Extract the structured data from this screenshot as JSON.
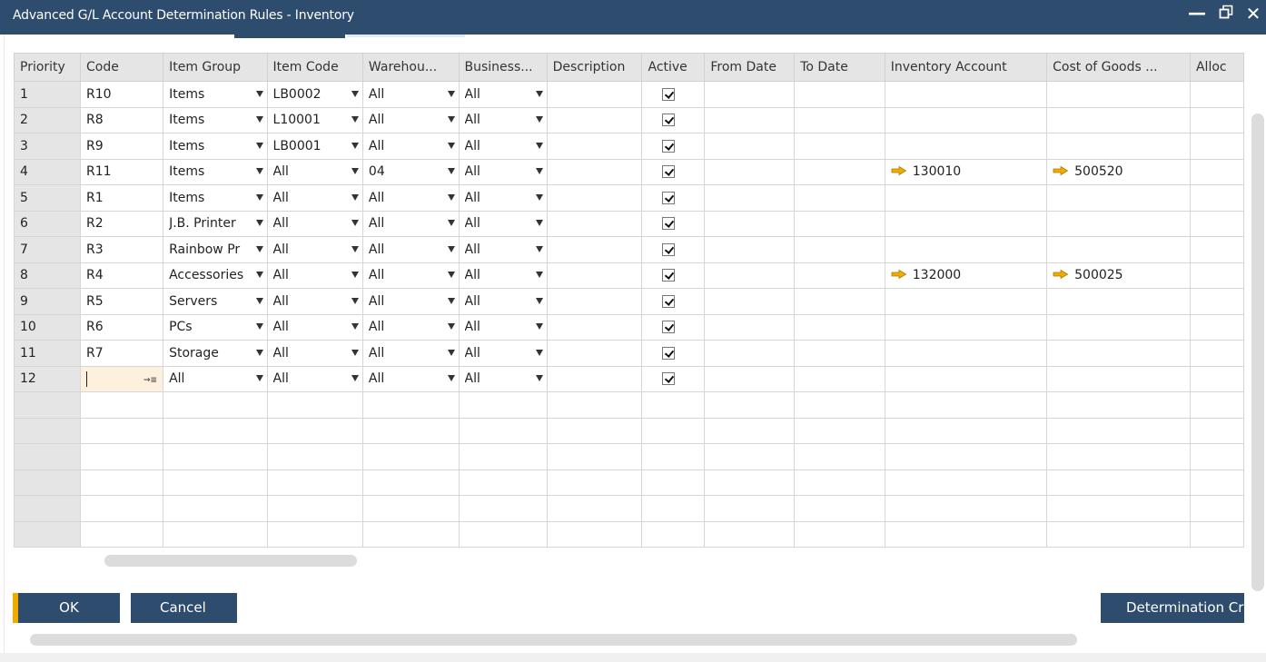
{
  "window": {
    "title": "Advanced G/L Account Determination Rules - Inventory",
    "controls": {
      "minimize": "_",
      "close": "✕"
    }
  },
  "grid": {
    "columns": [
      "Priority",
      "Code",
      "Item Group",
      "Item Code",
      "Warehou...",
      "Business...",
      "Description",
      "Active",
      "From Date",
      "To Date",
      "Inventory Account",
      "Cost of Goods ...",
      "Alloc"
    ],
    "rows": [
      {
        "priority": "1",
        "code": "R10",
        "item_group": "Items",
        "item_code": "LB0002",
        "warehouse": "All",
        "business": "All",
        "description": "",
        "active": true,
        "from_date": "",
        "to_date": "",
        "inventory_account": "",
        "cogs_account": "",
        "alloc": ""
      },
      {
        "priority": "2",
        "code": "R8",
        "item_group": "Items",
        "item_code": "L10001",
        "warehouse": "All",
        "business": "All",
        "description": "",
        "active": true,
        "from_date": "",
        "to_date": "",
        "inventory_account": "",
        "cogs_account": "",
        "alloc": ""
      },
      {
        "priority": "3",
        "code": "R9",
        "item_group": "Items",
        "item_code": "LB0001",
        "warehouse": "All",
        "business": "All",
        "description": "",
        "active": true,
        "from_date": "",
        "to_date": "",
        "inventory_account": "",
        "cogs_account": "",
        "alloc": ""
      },
      {
        "priority": "4",
        "code": "R11",
        "item_group": "Items",
        "item_code": "All",
        "warehouse": "04",
        "business": "All",
        "description": "",
        "active": true,
        "from_date": "",
        "to_date": "",
        "inventory_account": "130010",
        "cogs_account": "500520",
        "alloc": ""
      },
      {
        "priority": "5",
        "code": "R1",
        "item_group": "Items",
        "item_code": "All",
        "warehouse": "All",
        "business": "All",
        "description": "",
        "active": true,
        "from_date": "",
        "to_date": "",
        "inventory_account": "",
        "cogs_account": "",
        "alloc": ""
      },
      {
        "priority": "6",
        "code": "R2",
        "item_group": "J.B. Printer",
        "item_code": "All",
        "warehouse": "All",
        "business": "All",
        "description": "",
        "active": true,
        "from_date": "",
        "to_date": "",
        "inventory_account": "",
        "cogs_account": "",
        "alloc": ""
      },
      {
        "priority": "7",
        "code": "R3",
        "item_group": "Rainbow Pr",
        "item_code": "All",
        "warehouse": "All",
        "business": "All",
        "description": "",
        "active": true,
        "from_date": "",
        "to_date": "",
        "inventory_account": "",
        "cogs_account": "",
        "alloc": ""
      },
      {
        "priority": "8",
        "code": "R4",
        "item_group": "Accessories",
        "item_code": "All",
        "warehouse": "All",
        "business": "All",
        "description": "",
        "active": true,
        "from_date": "",
        "to_date": "",
        "inventory_account": "132000",
        "cogs_account": "500025",
        "alloc": ""
      },
      {
        "priority": "9",
        "code": "R5",
        "item_group": "Servers",
        "item_code": "All",
        "warehouse": "All",
        "business": "All",
        "description": "",
        "active": true,
        "from_date": "",
        "to_date": "",
        "inventory_account": "",
        "cogs_account": "",
        "alloc": ""
      },
      {
        "priority": "10",
        "code": "R6",
        "item_group": "PCs",
        "item_code": "All",
        "warehouse": "All",
        "business": "All",
        "description": "",
        "active": true,
        "from_date": "",
        "to_date": "",
        "inventory_account": "",
        "cogs_account": "",
        "alloc": ""
      },
      {
        "priority": "11",
        "code": "R7",
        "item_group": "Storage",
        "item_code": "All",
        "warehouse": "All",
        "business": "All",
        "description": "",
        "active": true,
        "from_date": "",
        "to_date": "",
        "inventory_account": "",
        "cogs_account": "",
        "alloc": ""
      },
      {
        "priority": "12",
        "code": "",
        "item_group": "All",
        "item_code": "All",
        "warehouse": "All",
        "business": "All",
        "description": "",
        "active": true,
        "from_date": "",
        "to_date": "",
        "inventory_account": "",
        "cogs_account": "",
        "alloc": "",
        "editing": true
      }
    ],
    "empty_rows": 6
  },
  "buttons": {
    "ok": "OK",
    "cancel": "Cancel",
    "determination": "Determination Criteria"
  },
  "colors": {
    "titlebar": "#2e4c6d",
    "button": "#2e4c6d",
    "accent": "#f0ab00",
    "link_arrow": "#f0ab00",
    "header_bg": "#e5e5e5",
    "active_cell_bg": "#fdf1de"
  }
}
